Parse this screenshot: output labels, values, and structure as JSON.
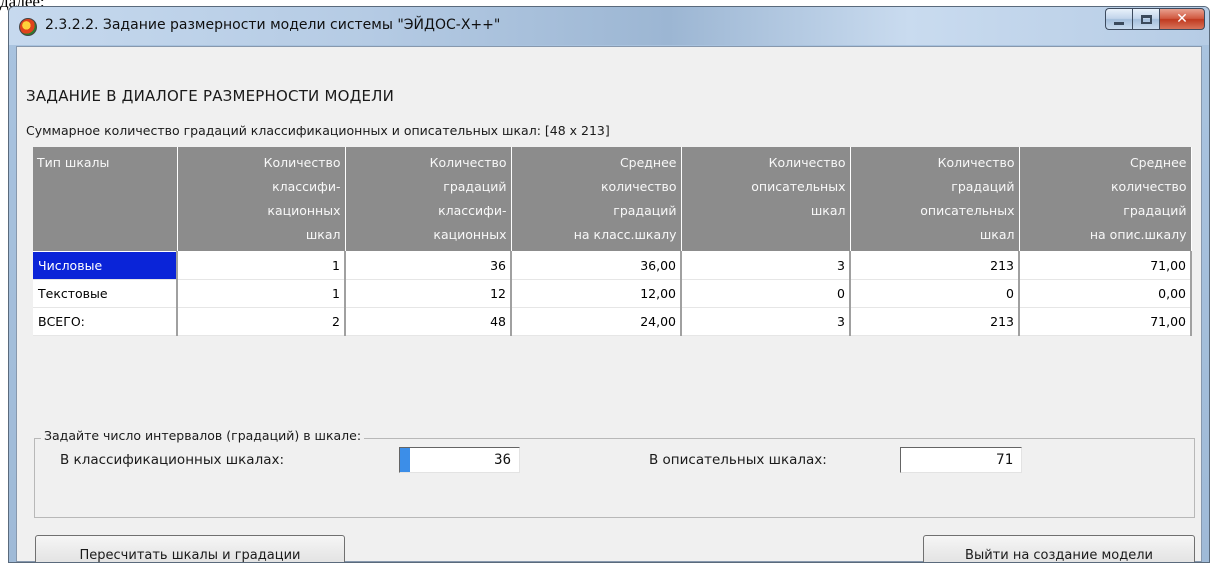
{
  "page_top_fragment": "далее:",
  "window": {
    "title": "2.3.2.2. Задание размерности модели системы \"ЭЙДОС-Х++\""
  },
  "dialog": {
    "heading": "ЗАДАНИЕ В ДИАЛОГЕ РАЗМЕРНОСТИ МОДЕЛИ",
    "summary": "Суммарное количество градаций классификационных и описательных шкал: [48 x 213]"
  },
  "table": {
    "columns": [
      [
        "Тип шкалы"
      ],
      [
        "Количество",
        "классифи-",
        "кационных",
        "шкал"
      ],
      [
        "Количество",
        "градаций",
        "классифи-",
        "кационных"
      ],
      [
        "Среднее",
        "количество",
        "градаций",
        "на класс.шкалу"
      ],
      [
        "Количество",
        "описательных",
        "шкал"
      ],
      [
        "Количество",
        "градаций",
        "описательных",
        "шкал"
      ],
      [
        "Среднее",
        "количество",
        "градаций",
        "на опис.шкалу"
      ]
    ],
    "rows": [
      [
        "Числовые",
        "1",
        "36",
        "36,00",
        "3",
        "213",
        "71,00"
      ],
      [
        "Текстовые",
        "1",
        "12",
        "12,00",
        "0",
        "0",
        "0,00"
      ],
      [
        "ВСЕГО:",
        "2",
        "48",
        "24,00",
        "3",
        "213",
        "71,00"
      ]
    ],
    "selected_row": 0
  },
  "intervals": {
    "group_label": "Задайте число интервалов (градаций) в шкале:",
    "class_label": "В классификационных шкалах:",
    "class_value": "36",
    "desc_label": "В описательных шкалах:",
    "desc_value": "71"
  },
  "buttons": {
    "recalc": "Пересчитать шкалы и градации",
    "exit": "Выйти на создание модели"
  },
  "icons": {
    "app": "eidos-app-icon",
    "minimize": "minimize-icon",
    "maximize": "maximize-icon",
    "close": "close-icon"
  }
}
